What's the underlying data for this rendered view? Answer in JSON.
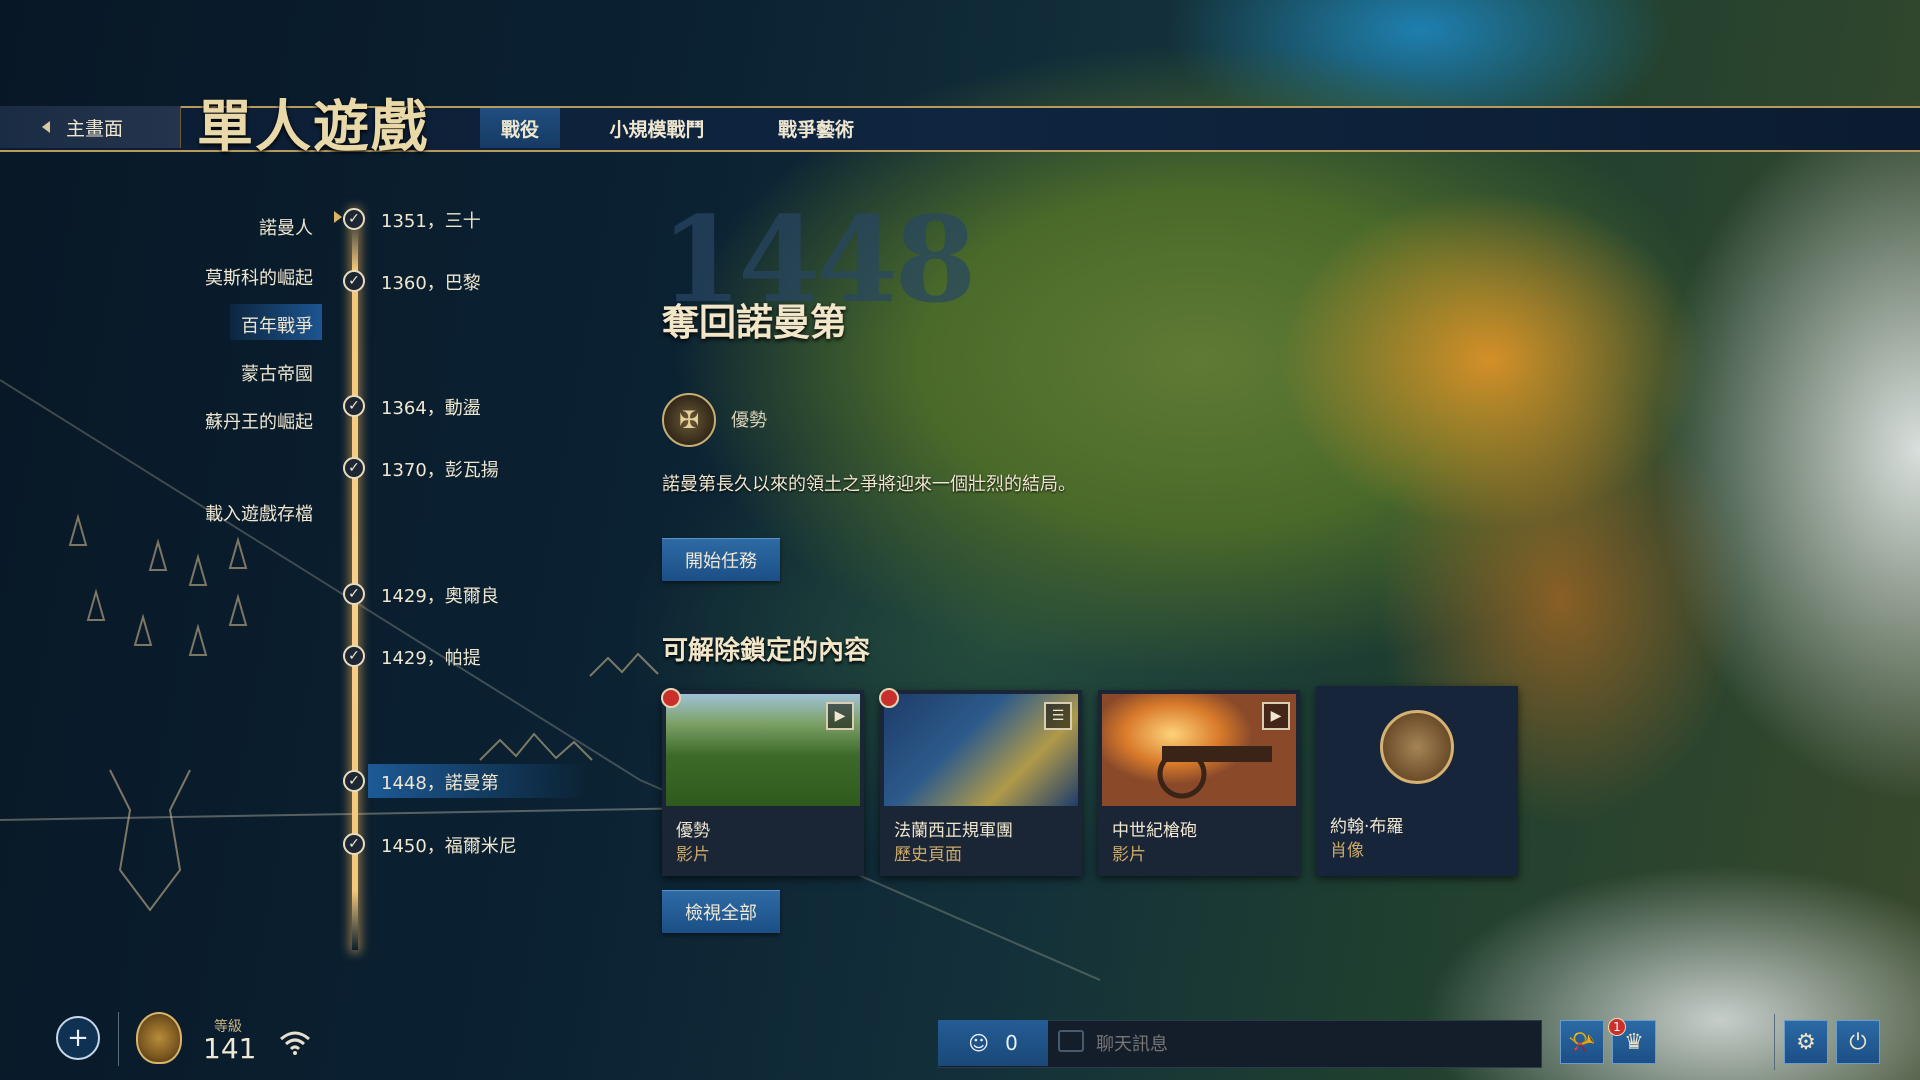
{
  "header": {
    "back_label": "主畫面",
    "title": "單人遊戲",
    "tabs": [
      {
        "label": "戰役",
        "active": true
      },
      {
        "label": "小規模戰鬥",
        "active": false
      },
      {
        "label": "戰爭藝術",
        "active": false
      }
    ]
  },
  "campaigns": {
    "items": [
      "諾曼人",
      "莫斯科的崛起",
      "百年戰爭",
      "蒙古帝國",
      "蘇丹王的崛起"
    ],
    "selected": "百年戰爭",
    "load_save": "載入遊戲存檔"
  },
  "timeline": [
    {
      "label": "1351，三十",
      "completed": true
    },
    {
      "label": "1360，巴黎",
      "completed": true
    },
    {
      "label": "1364，動盪",
      "completed": true
    },
    {
      "label": "1370，彭瓦揚",
      "completed": true
    },
    {
      "label": "1429，奧爾良",
      "completed": true
    },
    {
      "label": "1429，帕提",
      "completed": true
    },
    {
      "label": "1448，諾曼第",
      "completed": true,
      "selected": true
    },
    {
      "label": "1450，福爾米尼",
      "completed": true
    }
  ],
  "mission": {
    "year": "1448",
    "title": "奪回諾曼第",
    "badge_label": "優勢",
    "description": "諾曼第長久以來的領土之爭將迎來一個壯烈的結局。",
    "start_button": "開始任務"
  },
  "unlockables": {
    "heading": "可解除鎖定的內容",
    "cards": [
      {
        "name": "優勢",
        "type": "影片",
        "icon": "play-icon",
        "new": true
      },
      {
        "name": "法蘭西正規軍團",
        "type": "歷史頁面",
        "icon": "scroll-icon",
        "new": true
      },
      {
        "name": "中世紀槍砲",
        "type": "影片",
        "icon": "play-icon",
        "new": false
      },
      {
        "name": "約翰·布羅",
        "type": "肖像",
        "icon": "portrait-icon",
        "new": false
      }
    ],
    "view_all": "檢視全部"
  },
  "bottom": {
    "level_label": "等級",
    "level_value": "141",
    "friends_count": "0",
    "chat_placeholder": "聊天訊息",
    "notification_count": "1"
  }
}
